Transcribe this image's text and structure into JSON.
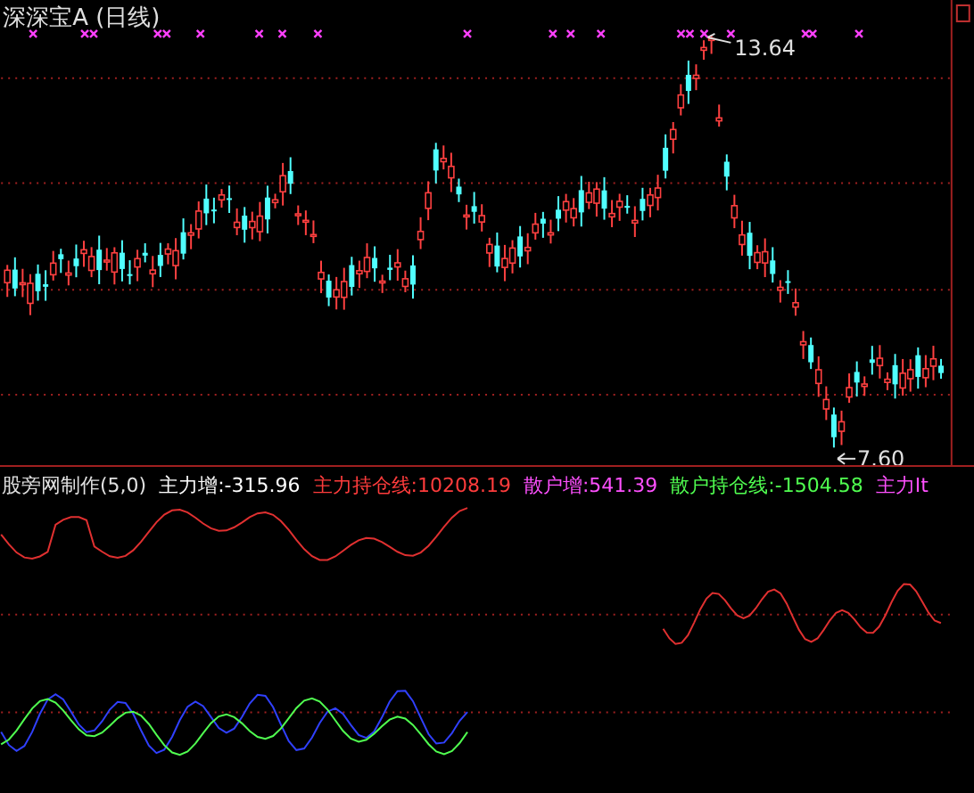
{
  "chart_title": "深深宝A (日线)",
  "high_label": "13.64",
  "low_label": "7.60",
  "indicator_legend": [
    {
      "text": "股旁网制作(5,0)",
      "color": "#e0e0e0"
    },
    {
      "text": "主力增:-315.96",
      "color": "#ffffff"
    },
    {
      "text": "主力持仓线:10208.19",
      "color": "#ff3c3c"
    },
    {
      "text": "散户增:541.39",
      "color": "#ff50ff"
    },
    {
      "text": "散户持仓线:-1504.58",
      "color": "#50ff50"
    },
    {
      "text": "主力It",
      "color": "#ff50ff"
    }
  ]
}
